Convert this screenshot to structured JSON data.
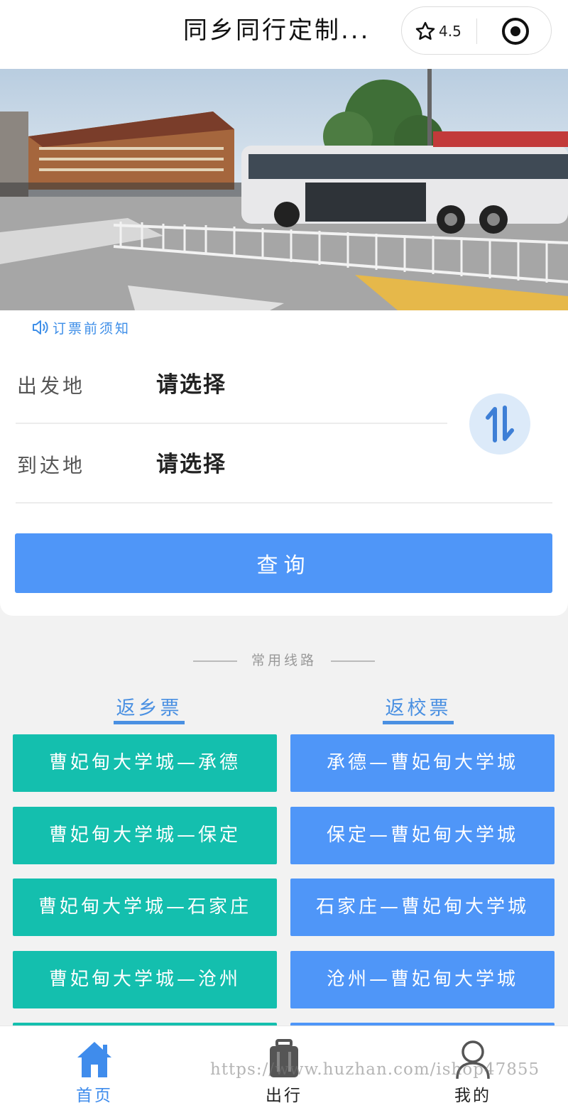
{
  "header": {
    "title": "同乡同行定制...",
    "rating": "4.5"
  },
  "notice": {
    "text": "订票前须知"
  },
  "booking": {
    "from_label": "出发地",
    "from_value": "请选择",
    "to_label": "到达地",
    "to_value": "请选择",
    "query_label": "查询"
  },
  "routes": {
    "section_title": "常用线路",
    "home_title": "返乡票",
    "school_title": "返校票",
    "home": [
      "曹妃甸大学城—承德",
      "曹妃甸大学城—保定",
      "曹妃甸大学城—石家庄",
      "曹妃甸大学城—沧州"
    ],
    "school": [
      "承德—曹妃甸大学城",
      "保定—曹妃甸大学城",
      "石家庄—曹妃甸大学城",
      "沧州—曹妃甸大学城"
    ]
  },
  "tabbar": {
    "items": [
      {
        "label": "首页",
        "icon": "home-icon",
        "active": true
      },
      {
        "label": "出行",
        "icon": "luggage-icon",
        "active": false
      },
      {
        "label": "我的",
        "icon": "user-icon",
        "active": false
      }
    ]
  },
  "watermark": "https://www.huzhan.com/ishop47855",
  "colors": {
    "accent_blue": "#4f96f8",
    "teal": "#14bfae",
    "link_blue": "#4a90e2"
  }
}
